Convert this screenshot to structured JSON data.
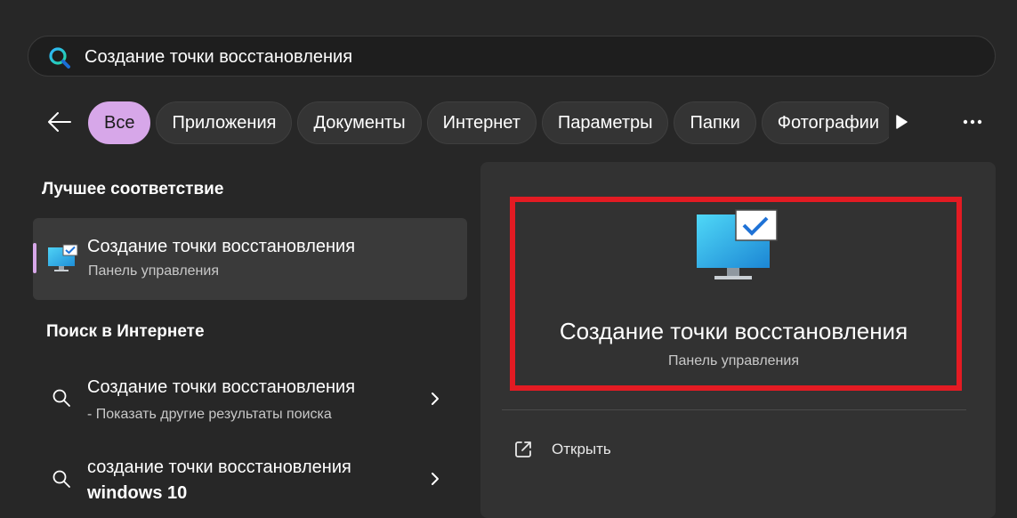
{
  "search": {
    "value": "Создание точки восстановления",
    "icon": "search-icon"
  },
  "filters": {
    "items": [
      {
        "label": "Все",
        "active": true
      },
      {
        "label": "Приложения"
      },
      {
        "label": "Документы"
      },
      {
        "label": "Интернет"
      },
      {
        "label": "Параметры"
      },
      {
        "label": "Папки"
      },
      {
        "label": "Фотографии"
      }
    ]
  },
  "best_match": {
    "heading": "Лучшее соответствие",
    "title": "Создание точки восстановления",
    "subtitle": "Панель управления"
  },
  "web_search": {
    "heading": "Поиск в Интернете",
    "items": [
      {
        "title": "Создание точки восстановления",
        "subtitle": "- Показать другие результаты поиска"
      },
      {
        "title": "создание точки восстановления",
        "title_bold": "windows 10"
      }
    ]
  },
  "detail": {
    "title": "Создание точки восстановления",
    "subtitle": "Панель управления",
    "open_label": "Открыть"
  },
  "colors": {
    "accent": "#d7a7e9",
    "highlight": "#e31b23",
    "background": "#272727",
    "panel": "#323232"
  }
}
